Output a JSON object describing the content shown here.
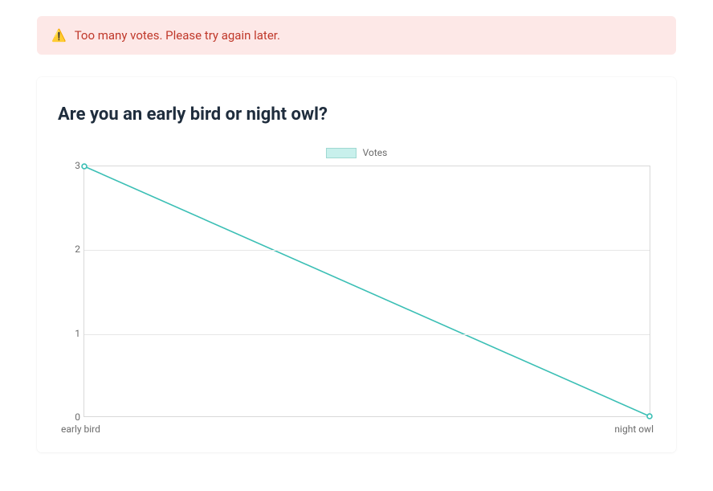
{
  "alert": {
    "icon": "⚠️",
    "text": "Too many votes. Please try again later."
  },
  "card": {
    "title": "Are you an early bird or night owl?"
  },
  "legend": {
    "label": "Votes"
  },
  "chart_data": {
    "type": "line",
    "categories": [
      "early bird",
      "night owl"
    ],
    "values": [
      3,
      0
    ],
    "series_name": "Votes",
    "ylim": [
      0,
      3
    ],
    "yticks": [
      0,
      1,
      2,
      3
    ],
    "line_color": "#3bbfb5",
    "fill_color": "#c8f0ec"
  }
}
